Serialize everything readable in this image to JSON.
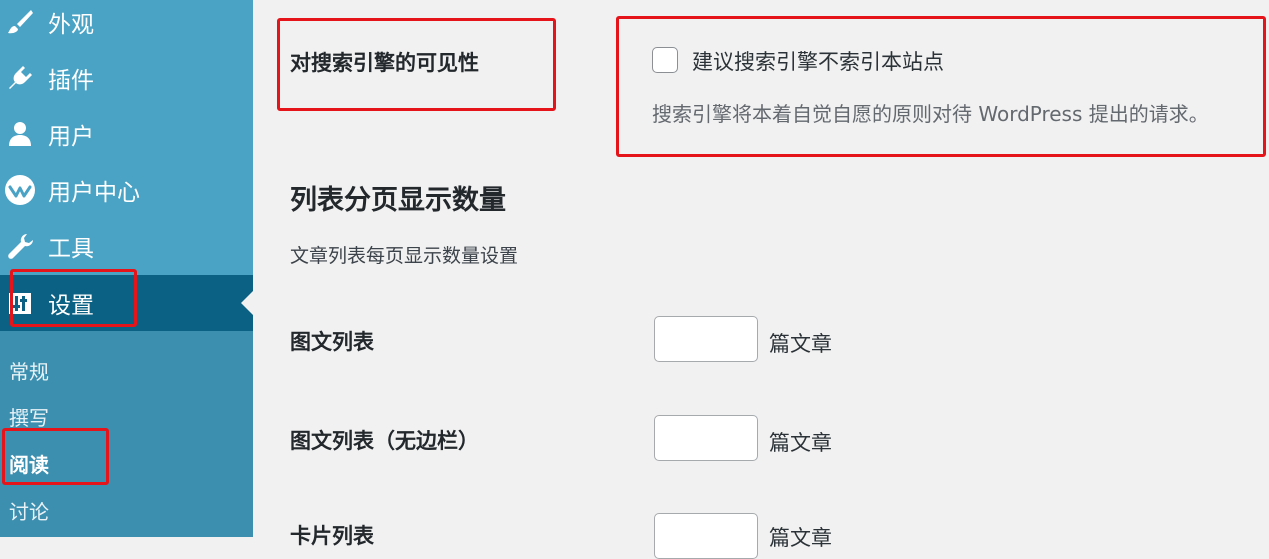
{
  "sidebar": {
    "menu": [
      {
        "label": "外观",
        "icon": "paint-brush-icon"
      },
      {
        "label": "插件",
        "icon": "plugin-icon"
      },
      {
        "label": "用户",
        "icon": "user-icon"
      },
      {
        "label": "用户中心",
        "icon": "user-center-icon"
      },
      {
        "label": "工具",
        "icon": "wrench-icon"
      },
      {
        "label": "设置",
        "icon": "settings-icon",
        "active": true
      }
    ],
    "submenu": [
      {
        "label": "常规"
      },
      {
        "label": "撰写"
      },
      {
        "label": "阅读",
        "current": true
      },
      {
        "label": "讨论"
      }
    ]
  },
  "visibility": {
    "heading": "对搜索引擎的可见性",
    "checkbox_label": "建议搜索引擎不索引本站点",
    "checked": false,
    "description": "搜索引擎将本着自觉自愿的原则对待 WordPress 提出的请求。"
  },
  "pagination": {
    "title": "列表分页显示数量",
    "description": "文章列表每页显示数量设置",
    "rows": [
      {
        "label": "图文列表",
        "value": "",
        "unit": "篇文章"
      },
      {
        "label": "图文列表（无边栏）",
        "value": "",
        "unit": "篇文章"
      },
      {
        "label": "卡片列表",
        "value": "",
        "unit": "篇文章"
      }
    ]
  },
  "colors": {
    "sidebar": "#4aa3c5",
    "sidebar_active": "#0a6184",
    "highlight": "#e5141b"
  }
}
